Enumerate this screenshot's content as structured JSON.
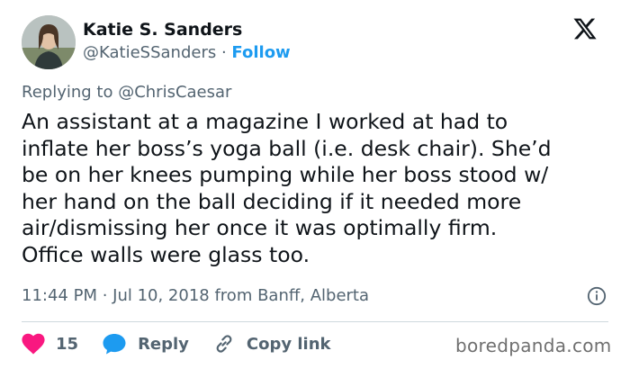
{
  "author": {
    "name": "Katie S. Sanders",
    "handle": "@KatieSSanders",
    "separator": "·",
    "follow_label": "Follow"
  },
  "reply_to": "Replying to @ChrisCaesar",
  "tweet": {
    "lines": [
      "An assistant at a magazine I worked at had to",
      "inflate her boss’s yoga ball (i.e. desk chair). She’d",
      "be on her knees pumping while her boss stood w/",
      "her hand on the ball deciding if it needed more",
      "air/dismissing her once it was optimally firm.",
      "Office walls were glass too."
    ]
  },
  "meta": {
    "timestamp": "11:44 PM · Jul 10, 2018 from Banff, Alberta"
  },
  "actions": {
    "like_count": "15",
    "reply_label": "Reply",
    "copy_link_label": "Copy link"
  },
  "watermark": "boredpanda.com",
  "icons": {
    "platform": "x-logo-icon",
    "info": "info-icon",
    "like": "heart-icon",
    "reply": "reply-bubble-icon",
    "copy": "link-icon"
  },
  "colors": {
    "text": "#0f1419",
    "secondary": "#536471",
    "accent": "#1d9bf0",
    "like": "#f91880",
    "divider": "#cfd9de"
  }
}
